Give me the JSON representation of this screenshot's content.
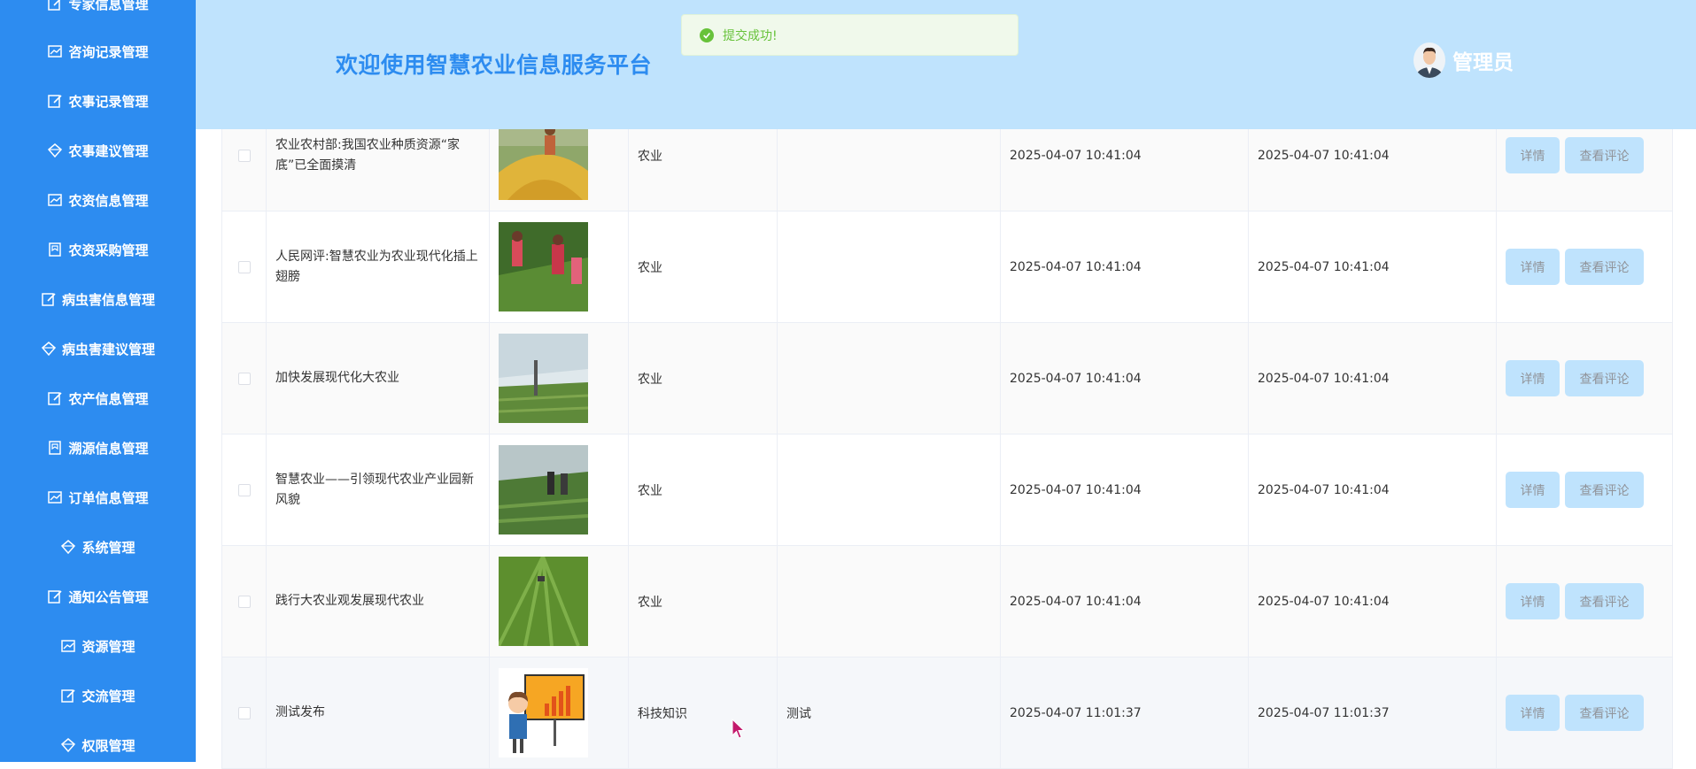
{
  "sidebar": {
    "items": [
      {
        "label": "专家信息管理",
        "icon": "edit-icon"
      },
      {
        "label": "咨询记录管理",
        "icon": "chart-icon"
      },
      {
        "label": "农事记录管理",
        "icon": "edit-icon"
      },
      {
        "label": "农事建议管理",
        "icon": "diamond-icon"
      },
      {
        "label": "农资信息管理",
        "icon": "chart-icon"
      },
      {
        "label": "农资采购管理",
        "icon": "bookmark-icon"
      },
      {
        "label": "病虫害信息管理",
        "icon": "edit-icon"
      },
      {
        "label": "病虫害建议管理",
        "icon": "diamond-icon"
      },
      {
        "label": "农产信息管理",
        "icon": "edit-icon"
      },
      {
        "label": "溯源信息管理",
        "icon": "bookmark-icon"
      },
      {
        "label": "订单信息管理",
        "icon": "chart-icon"
      },
      {
        "label": "系统管理",
        "icon": "diamond-icon"
      },
      {
        "label": "通知公告管理",
        "icon": "edit-icon"
      },
      {
        "label": "资源管理",
        "icon": "chart-icon"
      },
      {
        "label": "交流管理",
        "icon": "edit-icon"
      },
      {
        "label": "权限管理",
        "icon": "diamond-icon"
      }
    ]
  },
  "header": {
    "title": "欢迎使用智慧农业信息服务平台",
    "user_name": "管理员"
  },
  "toast": {
    "message": "提交成功!",
    "color": "#67c23a"
  },
  "table": {
    "rows": [
      {
        "title": "农业农村部:我国农业种质资源“家底”已全面摸清",
        "image": "grain-harvest-photo",
        "category": "农业",
        "content": "",
        "created": "2025-04-07 10:41:04",
        "updated": "2025-04-07 10:41:04"
      },
      {
        "title": "人民网评:智慧农业为农业现代化插上翅膀",
        "image": "field-workers-photo",
        "category": "农业",
        "content": "",
        "created": "2025-04-07 10:41:04",
        "updated": "2025-04-07 10:41:04"
      },
      {
        "title": "加快发展现代化大农业",
        "image": "greenhouse-photo",
        "category": "农业",
        "content": "",
        "created": "2025-04-07 10:41:04",
        "updated": "2025-04-07 10:41:04"
      },
      {
        "title": "智慧农业——引领现代农业产业园新风貌",
        "image": "greenhouse-visit-photo",
        "category": "农业",
        "content": "",
        "created": "2025-04-07 10:41:04",
        "updated": "2025-04-07 10:41:04"
      },
      {
        "title": "践行大农业观发展现代农业",
        "image": "crop-rows-photo",
        "category": "农业",
        "content": "",
        "created": "2025-04-07 10:41:04",
        "updated": "2025-04-07 10:41:04"
      },
      {
        "title": "测试发布",
        "image": "presenter-chart-illustration",
        "category": "科技知识",
        "content": "测试",
        "created": "2025-04-07 11:01:37",
        "updated": "2025-04-07 11:01:37"
      }
    ],
    "detail_label": "详情",
    "comment_label": "查看评论"
  },
  "colors": {
    "sidebar": "#2d8cf0",
    "header": "#bfe3fd",
    "button": "#bfe3fd",
    "title": "#2d8cf0"
  }
}
